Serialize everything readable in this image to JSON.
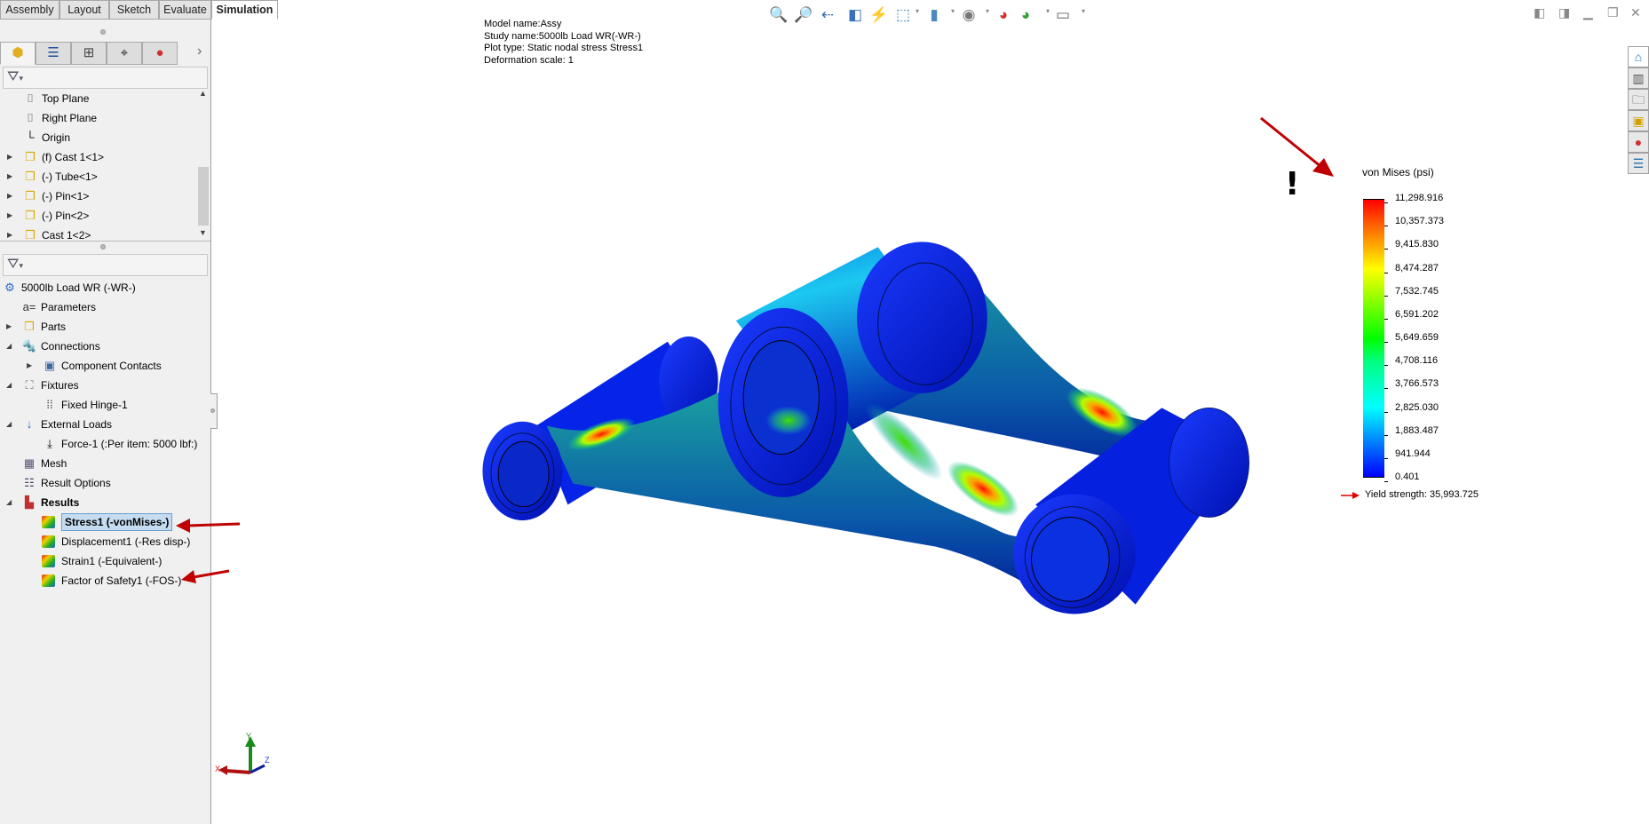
{
  "command_tabs": [
    {
      "label": "Assembly"
    },
    {
      "label": "Layout"
    },
    {
      "label": "Sketch"
    },
    {
      "label": "Evaluate"
    },
    {
      "label": "Simulation",
      "active": true
    }
  ],
  "manager_tabs": [
    {
      "icon": "featuremanager-icon"
    },
    {
      "icon": "propertymanager-icon"
    },
    {
      "icon": "configurationmanager-icon"
    },
    {
      "icon": "dimxpert-icon"
    },
    {
      "icon": "display-manager-icon"
    }
  ],
  "feature_tree": [
    {
      "label": "Top Plane",
      "icon": "plane-icon"
    },
    {
      "label": "Right Plane",
      "icon": "plane-icon"
    },
    {
      "label": "Origin",
      "icon": "origin-icon"
    },
    {
      "label": "(f) Cast 1<1>",
      "icon": "part-icon",
      "expandable": true
    },
    {
      "label": "(-) Tube<1>",
      "icon": "part-icon",
      "expandable": true
    },
    {
      "label": "(-) Pin<1>",
      "icon": "part-icon",
      "expandable": true
    },
    {
      "label": "(-) Pin<2>",
      "icon": "part-icon",
      "expandable": true
    },
    {
      "label": "Cast 1<2>",
      "icon": "part-icon",
      "expandable": true
    }
  ],
  "study_tree": [
    {
      "label": "5000lb Load WR (-WR-)",
      "icon": "study-icon",
      "level": 0
    },
    {
      "label": "Parameters",
      "icon": "parameters-icon",
      "level": 1
    },
    {
      "label": "Parts",
      "icon": "parts-icon",
      "level": 1,
      "expander": "collapsed"
    },
    {
      "label": "Connections",
      "icon": "connections-icon",
      "level": 1,
      "expander": "expanded"
    },
    {
      "label": "Component Contacts",
      "icon": "contacts-icon",
      "level": 2,
      "expander": "collapsed"
    },
    {
      "label": "Fixtures",
      "icon": "fixtures-icon",
      "level": 1,
      "expander": "expanded"
    },
    {
      "label": "Fixed Hinge-1",
      "icon": "hinge-icon",
      "level": 2
    },
    {
      "label": "External Loads",
      "icon": "external-loads-icon",
      "level": 1,
      "expander": "expanded"
    },
    {
      "label": "Force-1 (:Per item: 5000 lbf:)",
      "icon": "force-icon",
      "level": 2
    },
    {
      "label": "Mesh",
      "icon": "mesh-icon",
      "level": 1
    },
    {
      "label": "Result Options",
      "icon": "result-options-icon",
      "level": 1
    },
    {
      "label": "Results",
      "icon": "results-folder-icon",
      "level": 1,
      "expander": "expanded",
      "bold": true
    },
    {
      "label": "Stress1 (-vonMises-)",
      "icon": "stress-plot-icon",
      "level": 2,
      "selected": true
    },
    {
      "label": "Displacement1 (-Res disp-)",
      "icon": "displacement-plot-icon",
      "level": 2
    },
    {
      "label": "Strain1 (-Equivalent-)",
      "icon": "strain-plot-icon",
      "level": 2
    },
    {
      "label": "Factor of Safety1 (-FOS-)",
      "icon": "fos-plot-icon",
      "level": 2
    }
  ],
  "plot_info": {
    "model": "Model name:Assy",
    "study": "Study name:5000lb Load WR(-WR-)",
    "plot_type": "Plot type: Static nodal stress Stress1",
    "deformation": "Deformation scale: 1"
  },
  "view_toolbar": [
    "zoom-to-fit-icon",
    "zoom-to-area-icon",
    "previous-view-icon",
    "section-view-icon",
    "dynamic-annotation-icon",
    "view-orientation-icon",
    "display-style-icon",
    "hide-show-icon",
    "edit-appearance-icon",
    "apply-scene-icon",
    "view-settings-icon"
  ],
  "window_controls": [
    "tile-left-icon",
    "tile-right-icon",
    "minimize-icon",
    "restore-icon",
    "close-icon"
  ],
  "task_pane": [
    "home-icon",
    "design-library-icon",
    "file-explorer-icon",
    "view-palette-icon",
    "appearances-icon",
    "custom-properties-icon"
  ],
  "legend": {
    "title": "von Mises (psi)",
    "labels": [
      "11,298.916",
      "10,357.373",
      "9,415.830",
      "8,474.287",
      "7,532.745",
      "6,591.202",
      "5,649.659",
      "4,708.116",
      "3,766.573",
      "2,825.030",
      "1,883.487",
      "941.944",
      "0.401"
    ],
    "colors": [
      "#ff0000",
      "#ff5a00",
      "#ffaa00",
      "#ffff00",
      "#aaff00",
      "#55ff00",
      "#00ff00",
      "#00ff80",
      "#00ffc0",
      "#00ffff",
      "#00aaff",
      "#0055ff",
      "#0000ff"
    ],
    "yield": "Yield strength: 35,993.725",
    "yield_marker_color": "#e00000"
  },
  "warning_mark": "!",
  "triad": {
    "x": "X",
    "y": "Y",
    "z": "Z"
  },
  "annotation_color": "#c00000"
}
